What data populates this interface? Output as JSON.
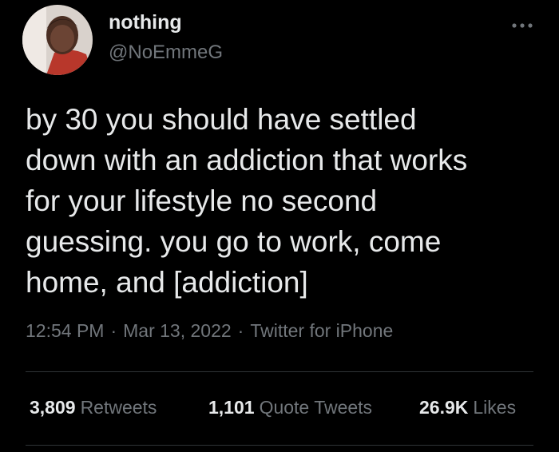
{
  "user": {
    "display_name": "nothing",
    "handle": "@NoEmmeG",
    "avatar_icon": "profile-photo"
  },
  "menu": {
    "icon": "more-dots-icon"
  },
  "tweet": {
    "text": "by 30 you should have settled\ndown with an addiction that works\nfor your lifestyle no second\nguessing. you go to work, come\nhome, and [addiction]"
  },
  "meta": {
    "time": "12:54 PM",
    "date": "Mar 13, 2022",
    "source": "Twitter for iPhone",
    "separator": "·"
  },
  "stats": {
    "retweets": {
      "count": "3,809",
      "label": "Retweets"
    },
    "quotes": {
      "count": "1,101",
      "label": "Quote Tweets"
    },
    "likes": {
      "count": "26.9K",
      "label": "Likes"
    }
  },
  "colors": {
    "background": "#000000",
    "primary_text": "#e7e9ea",
    "secondary_text": "#71767b",
    "divider": "#2f3336"
  }
}
